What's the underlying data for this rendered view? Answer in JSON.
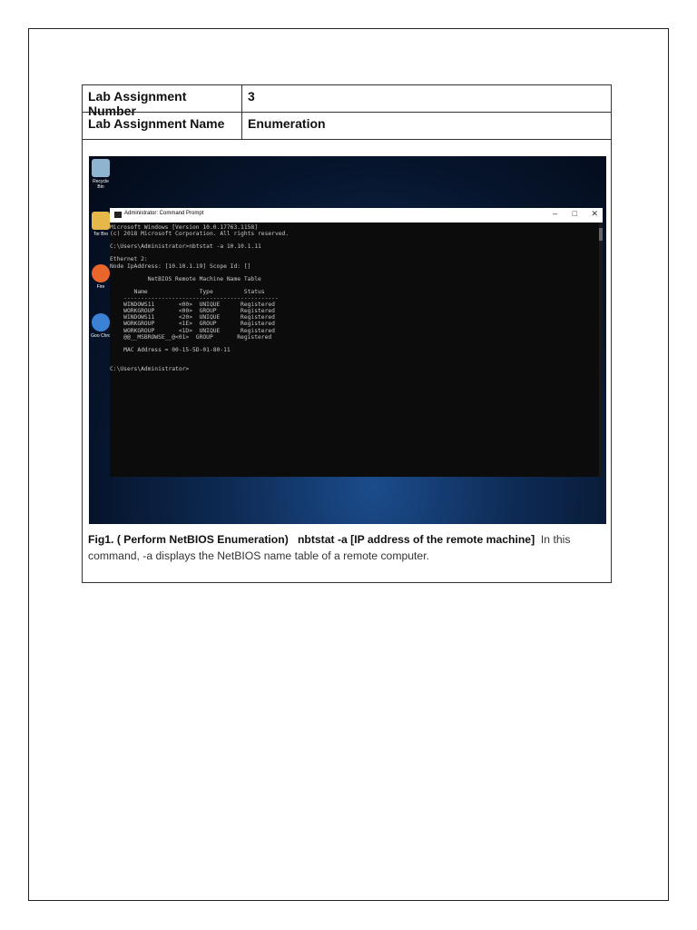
{
  "table": {
    "rows": [
      {
        "label": "Lab Assignment Number",
        "value": "3"
      },
      {
        "label": "Lab Assignment Name",
        "value": "Enumeration"
      }
    ]
  },
  "desktop": {
    "icons": [
      "Recycle Bin",
      "Tor Bro",
      "Fire",
      "Goo Chro"
    ]
  },
  "cmd": {
    "title": "Administrator: Command Prompt",
    "lines": [
      "Microsoft Windows [Version 10.0.17763.1158]",
      "(c) 2018 Microsoft Corporation. All rights reserved.",
      "",
      "C:\\Users\\Administrator>nbtstat -a 10.10.1.11",
      "",
      "Ethernet 2:",
      "Node IpAddress: [10.10.1.19] Scope Id: []",
      "",
      "           NetBIOS Remote Machine Name Table",
      "",
      "       Name               Type         Status",
      "    ---------------------------------------------",
      "    WINDOWS11       <00>  UNIQUE      Registered",
      "    WORKGROUP       <00>  GROUP       Registered",
      "    WINDOWS11       <20>  UNIQUE      Registered",
      "    WORKGROUP       <1E>  GROUP       Registered",
      "    WORKGROUP       <1D>  UNIQUE      Registered",
      "    @@__MSBROWSE__@<01>  GROUP       Registered",
      "",
      "    MAC Address = 00-15-5D-01-80-11",
      "",
      "",
      "C:\\Users\\Administrator>"
    ]
  },
  "caption": {
    "fig": "Fig1. ( Perform NetBIOS Enumeration)",
    "cmd": "nbtstat -a [IP address of the remote machine]",
    "text": "In this command, -a displays the NetBIOS name table of a remote computer."
  }
}
